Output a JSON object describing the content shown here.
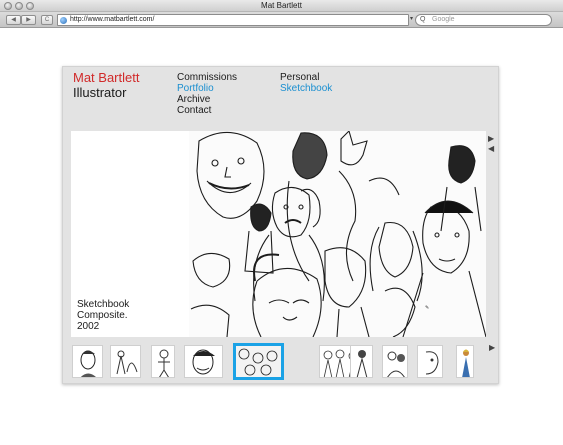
{
  "browser": {
    "window_title": "Mat Bartlett",
    "back_glyph": "◀",
    "forward_glyph": "▶",
    "reload_glyph": "C",
    "url": "http://www.matbartlett.com/",
    "search_placeholder": "Google",
    "search_icon_glyph": "Q",
    "dropdown_glyph": "▾"
  },
  "site": {
    "name": "Mat Bartlett",
    "subtitle": "Illustrator",
    "nav": [
      {
        "label": "Commissions",
        "active": false
      },
      {
        "label": "Portfolio",
        "active": true
      },
      {
        "label": "Archive",
        "active": false
      },
      {
        "label": "Contact",
        "active": false
      },
      {
        "label": "Personal",
        "active": false
      },
      {
        "label": "Sketchbook",
        "active": true
      }
    ],
    "caption": [
      "Sketchbook",
      "Composite.",
      "2002"
    ],
    "next_arrow": "▶",
    "prev_arrow": "◀"
  },
  "colors": {
    "brand_red": "#d12a2a",
    "link_blue": "#1b8fd0",
    "selection_blue": "#1aa2e6",
    "panel_gray": "#e3e3e3"
  },
  "thumbnails": [
    {
      "name": "thumb-portrait-man",
      "selected": false
    },
    {
      "name": "thumb-sketch-figures",
      "selected": false
    },
    {
      "name": "thumb-standing-figure",
      "selected": false
    },
    {
      "name": "thumb-face-closeup",
      "selected": false
    },
    {
      "name": "thumb-sketchbook-composite",
      "selected": true
    },
    {
      "name": "thumb-crowd-scene",
      "selected": false
    },
    {
      "name": "thumb-single-figure",
      "selected": false
    },
    {
      "name": "thumb-group-sketch",
      "selected": false
    },
    {
      "name": "thumb-profile-sketch",
      "selected": false
    },
    {
      "name": "thumb-color-figure",
      "selected": false
    }
  ]
}
